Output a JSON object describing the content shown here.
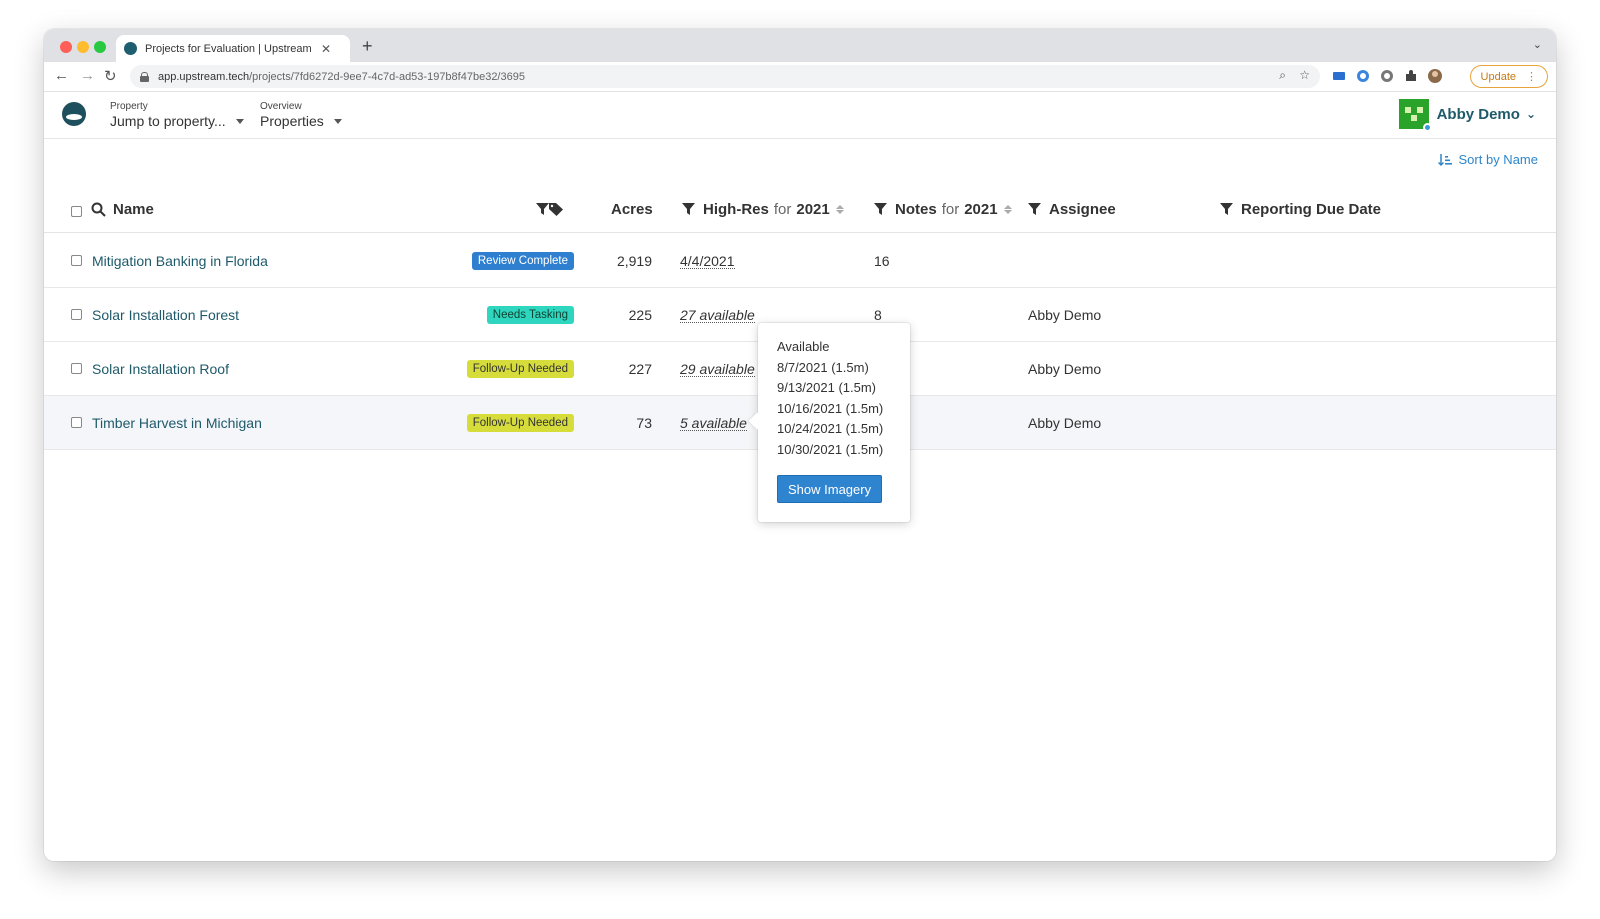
{
  "browser": {
    "tab_title": "Projects for Evaluation | Upstream",
    "url_host": "app.upstream.tech",
    "url_path": "/projects/7fd6272d-9ee7-4c7d-ad53-197b8f47be32/3695",
    "update_label": "Update"
  },
  "header": {
    "property_label": "Property",
    "property_value": "Jump to property...",
    "overview_label": "Overview",
    "overview_value": "Properties",
    "user_name": "Abby Demo"
  },
  "toolbar": {
    "sort_label": "Sort by Name"
  },
  "table": {
    "columns": {
      "name": "Name",
      "acres": "Acres",
      "highres": "High-Res",
      "highres_for": "for",
      "highres_year": "2021",
      "notes": "Notes",
      "notes_for": "for",
      "notes_year": "2021",
      "assignee": "Assignee",
      "due": "Reporting Due Date"
    },
    "rows": [
      {
        "name": "Mitigation Banking in Florida",
        "status": "Review Complete",
        "acres": "2,919",
        "highres": "4/4/2021",
        "notes": "16",
        "assignee": ""
      },
      {
        "name": "Solar Installation Forest",
        "status": "Needs Tasking",
        "acres": "225",
        "highres": "27 available",
        "notes": "8",
        "assignee": "Abby Demo"
      },
      {
        "name": "Solar Installation Roof",
        "status": "Follow-Up Needed",
        "acres": "227",
        "highres": "29 available",
        "notes": "",
        "assignee": "Abby Demo"
      },
      {
        "name": "Timber Harvest in Michigan",
        "status": "Follow-Up Needed",
        "acres": "73",
        "highres": "5 available",
        "notes": "",
        "assignee": "Abby Demo"
      }
    ]
  },
  "popover": {
    "title": "Available",
    "items": [
      "8/7/2021 (1.5m)",
      "9/13/2021 (1.5m)",
      "10/16/2021 (1.5m)",
      "10/24/2021 (1.5m)",
      "10/30/2021 (1.5m)"
    ],
    "button": "Show Imagery"
  },
  "colors": {
    "accent": "#2f84d0",
    "link": "#1e5a6a",
    "status_review_complete": "#2f7fd0",
    "status_needs_tasking": "#2ed6c0",
    "status_follow_up": "#d6dd3b"
  }
}
